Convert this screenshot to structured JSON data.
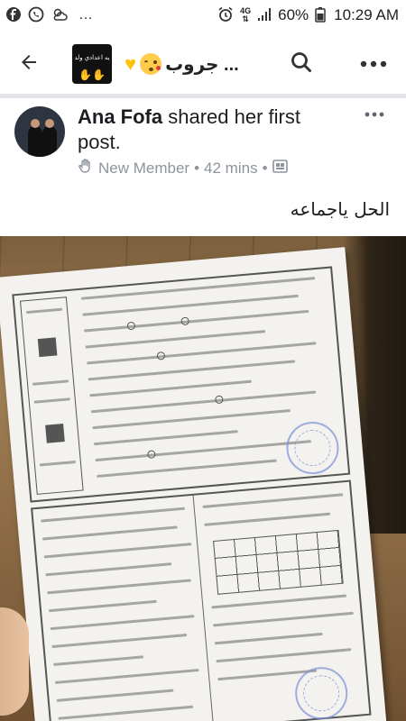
{
  "status_bar": {
    "network": "4G",
    "battery": "60%",
    "time": "10:29 AM",
    "icons": [
      "facebook-icon",
      "whatsapp-icon",
      "weather-icon",
      "more-dots-icon",
      "alarm-icon",
      "vibrate-icon",
      "signal-icon",
      "battery-icon"
    ]
  },
  "header": {
    "group_name": "جروب ...",
    "group_thumb_text": "يه اعدادي ولد",
    "icons": [
      "back-arrow-icon",
      "search-icon",
      "more-icon"
    ]
  },
  "post": {
    "author": "Ana Fofa",
    "action": "shared her first post.",
    "badge": "New Member",
    "separator": "•",
    "time": "42 mins",
    "text": "الحل ياجماعه",
    "icons": [
      "new-member-wave-icon",
      "group-audience-icon",
      "post-more-icon"
    ]
  },
  "colors": {
    "text_primary": "#1c1e21",
    "text_secondary": "#8d949e",
    "divider": "#e4e5e9",
    "heart": "#ffc107"
  }
}
